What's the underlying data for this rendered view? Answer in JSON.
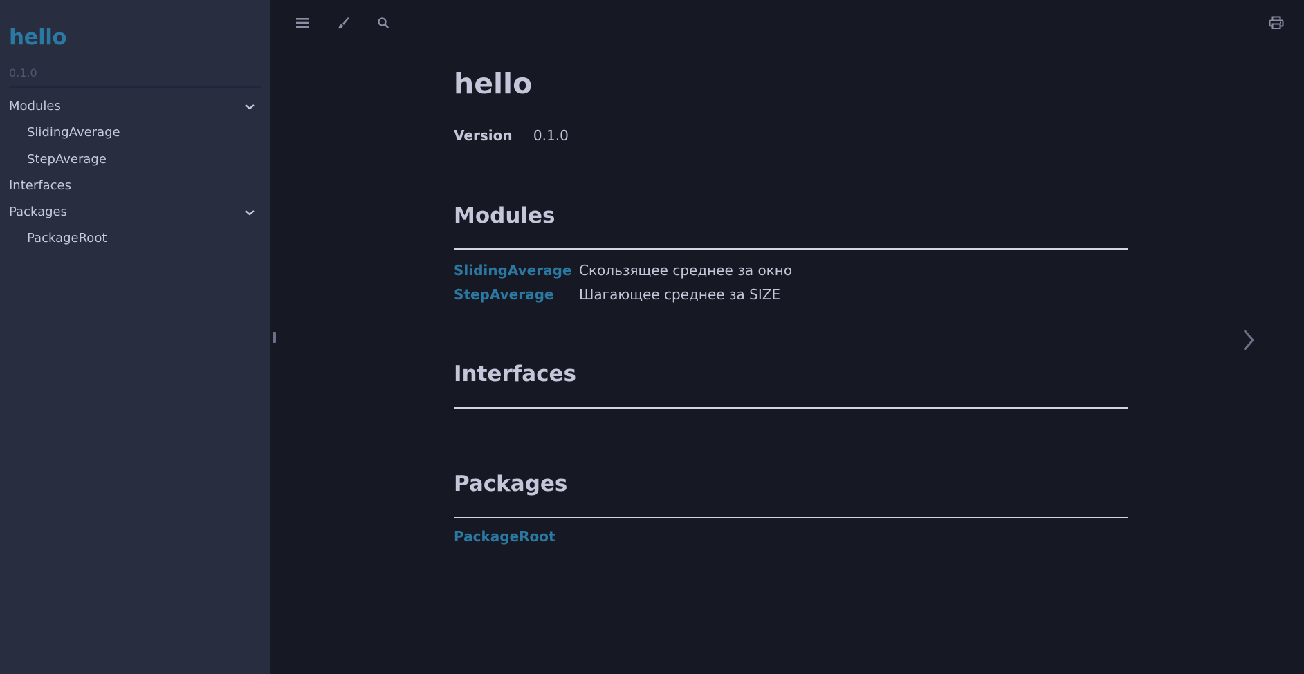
{
  "colors": {
    "sidebar_bg": "#282d3f",
    "content_bg": "#161923",
    "link": "#2b79a2",
    "text": "#c4c6d9",
    "muted": "#505870"
  },
  "sidebar": {
    "title": "hello",
    "version": "0.1.0",
    "items": [
      {
        "label": "Modules",
        "level": 0,
        "expandable": true,
        "icon": "chevron-down-icon"
      },
      {
        "label": "SlidingAverage",
        "level": 1
      },
      {
        "label": "StepAverage",
        "level": 1
      },
      {
        "label": "Interfaces",
        "level": 0
      },
      {
        "label": "Packages",
        "level": 0,
        "expandable": true,
        "icon": "chevron-down-icon"
      },
      {
        "label": "PackageRoot",
        "level": 1
      }
    ]
  },
  "toolbar": {
    "icons": [
      "menu-icon",
      "brush-icon",
      "search-icon"
    ],
    "print_icon": "print-icon"
  },
  "main": {
    "title": "hello",
    "version_label": "Version",
    "version_value": "0.1.0",
    "sections": [
      {
        "heading": "Modules",
        "rows": [
          {
            "name": "SlidingAverage",
            "description": "Скользящее среднее за окно"
          },
          {
            "name": "StepAverage",
            "description": "Шагающее среднее за SIZE"
          }
        ]
      },
      {
        "heading": "Interfaces",
        "rows": []
      },
      {
        "heading": "Packages",
        "rows": [
          {
            "name": "PackageRoot",
            "description": ""
          }
        ]
      }
    ]
  },
  "nav": {
    "next_icon": "chevron-right-icon"
  }
}
